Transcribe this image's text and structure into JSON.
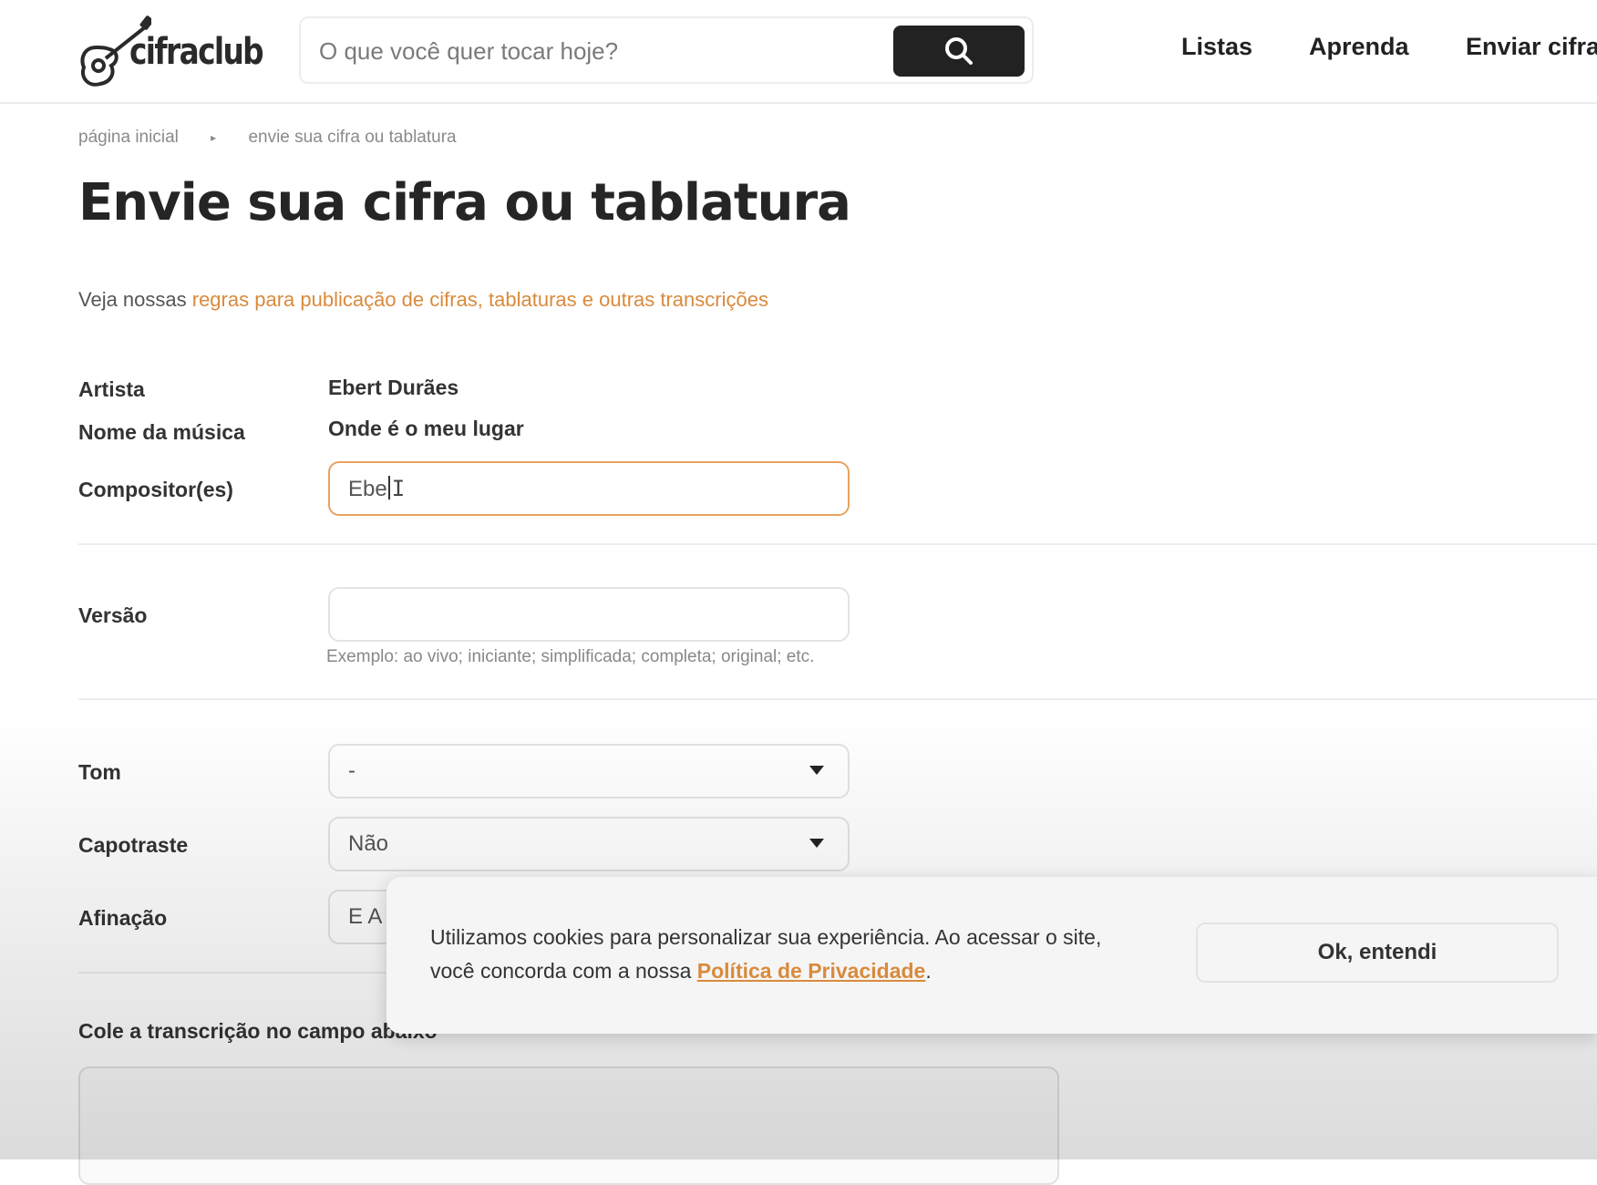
{
  "header": {
    "logo_text": "cifraclub",
    "search": {
      "placeholder": "O que você quer tocar hoje?",
      "value": ""
    },
    "nav": [
      "Listas",
      "Aprenda",
      "Enviar cifra"
    ]
  },
  "breadcrumb": [
    "página inicial",
    "envie sua cifra ou tablatura"
  ],
  "page_title": "Envie sua cifra ou tablatura",
  "rules": {
    "prefix": "Veja nossas ",
    "link": "regras para publicação de cifras, tablaturas e outras transcrições"
  },
  "form": {
    "artist": {
      "label": "Artista",
      "value": "Ebert Durães"
    },
    "song": {
      "label": "Nome da música",
      "value": "Onde é o meu lugar"
    },
    "composers": {
      "label": "Compositor(es)",
      "value": "Ebe"
    },
    "version": {
      "label": "Versão",
      "value": "",
      "hint": "Exemplo: ao vivo; iniciante; simplificada; completa; original; etc."
    },
    "key": {
      "label": "Tom",
      "value": "-"
    },
    "capo": {
      "label": "Capotraste",
      "value": "Não"
    },
    "tuning": {
      "label": "Afinação",
      "value": "E A"
    },
    "transcription": {
      "label": "Cole a transcrição no campo abaixo"
    }
  },
  "cookie": {
    "text": "Utilizamos cookies para personalizar sua experiência. Ao acessar o site, você concorda com a nossa ",
    "link": "Política de Privacidade",
    "suffix": ".",
    "button": "Ok, entendi"
  },
  "colors": {
    "accent": "#d98a3c",
    "dark_button": "#222222"
  }
}
